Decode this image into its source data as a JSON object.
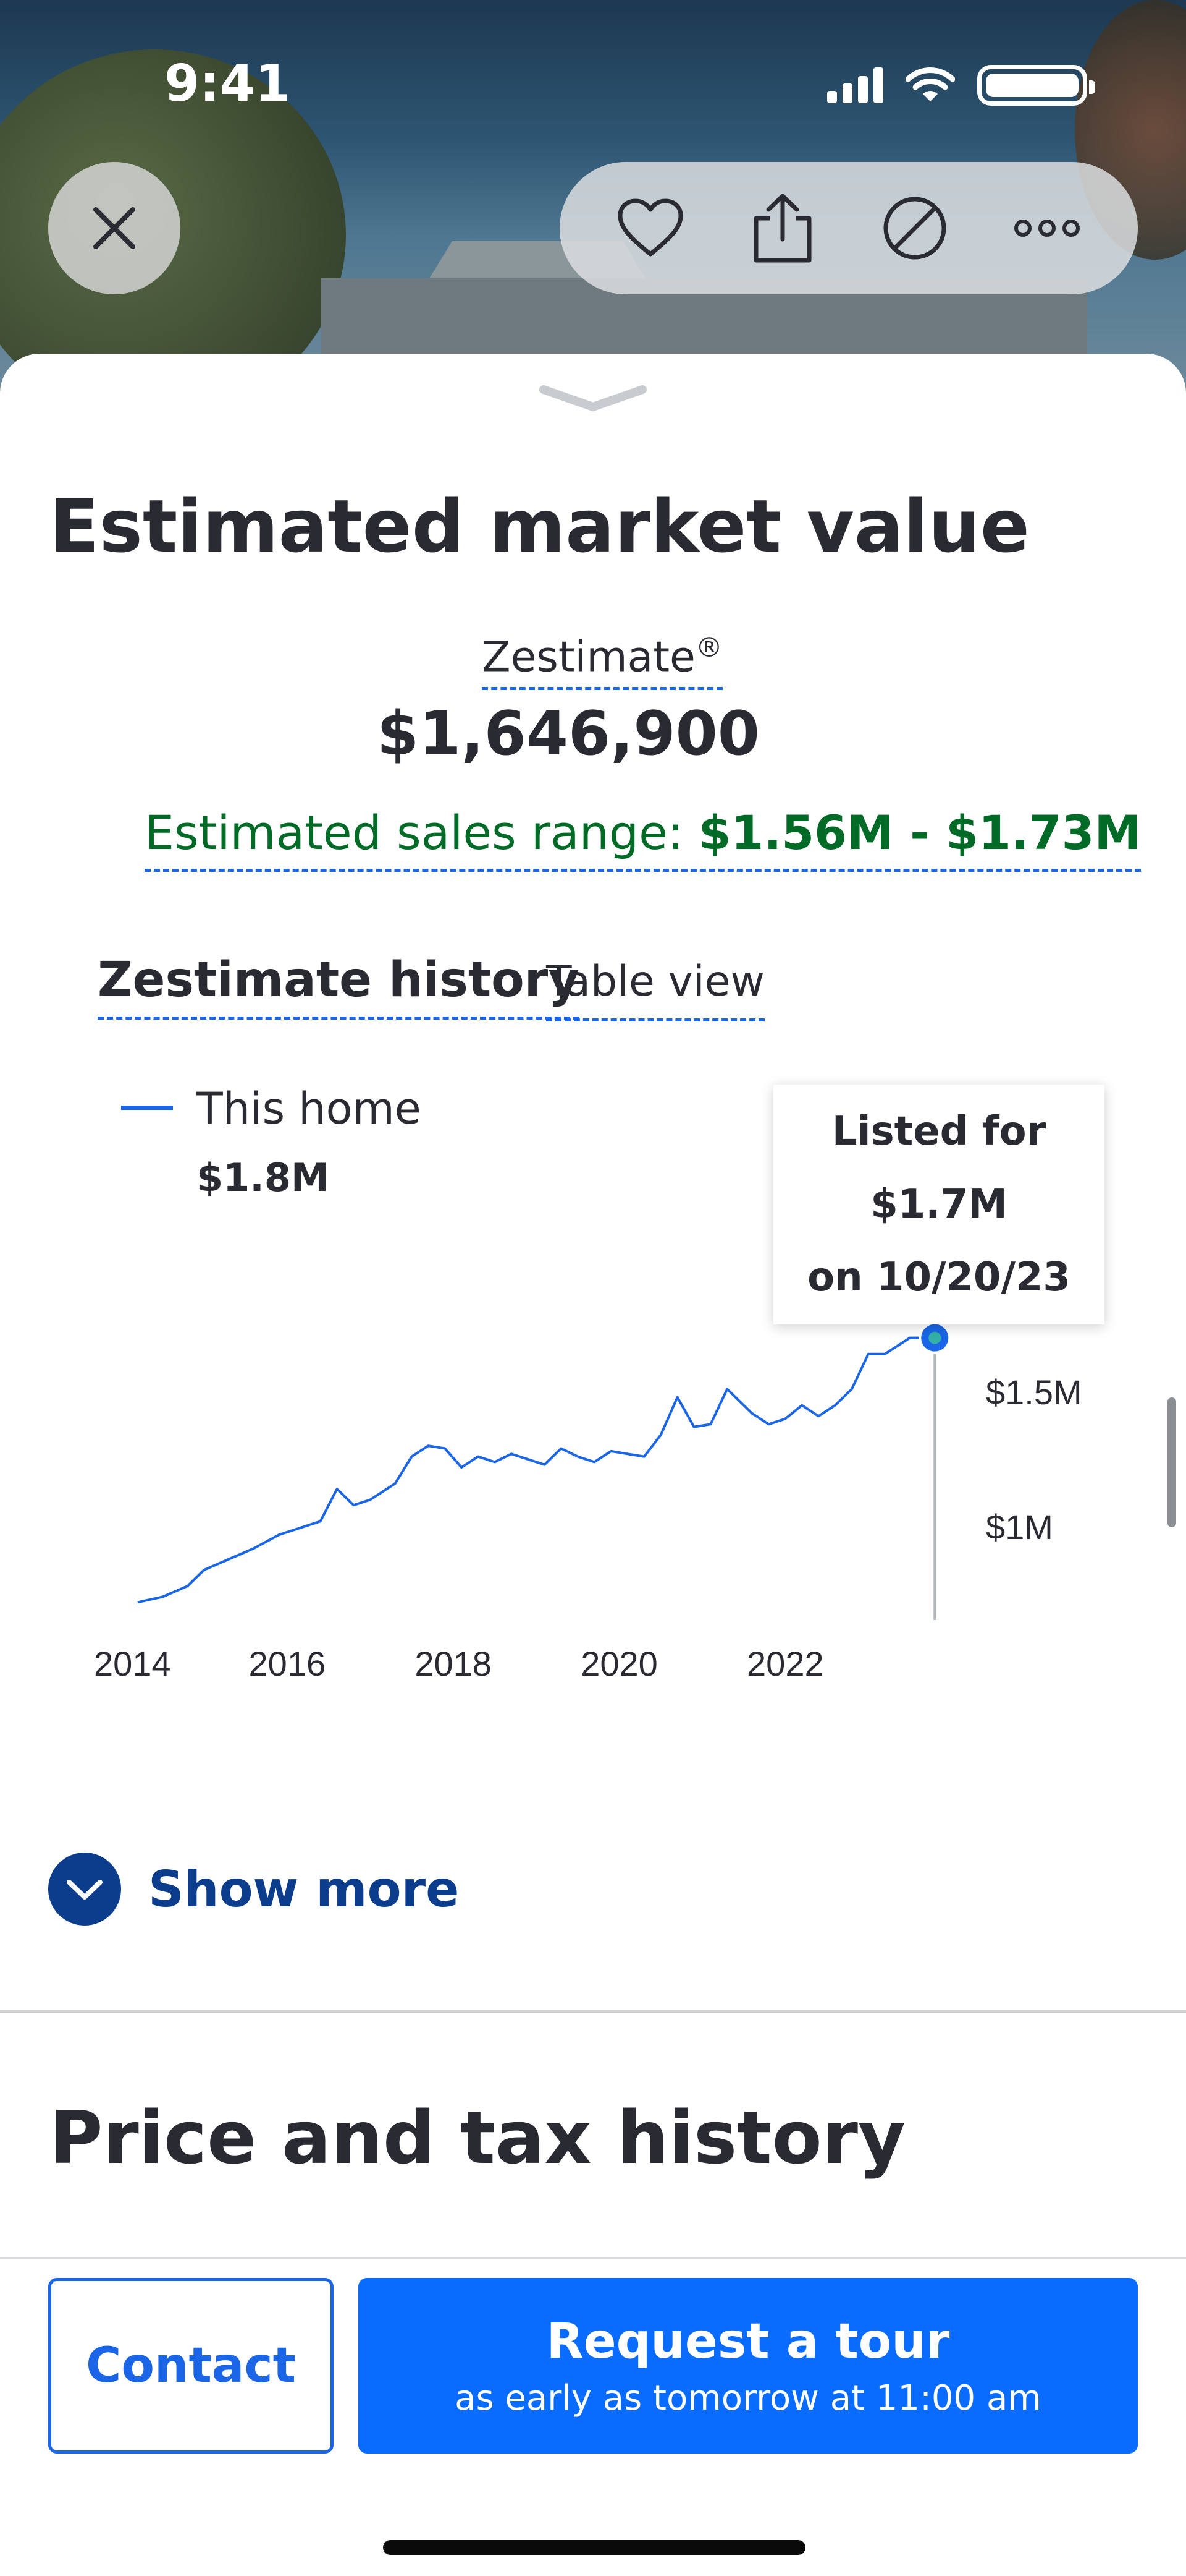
{
  "status_bar": {
    "time": "9:41"
  },
  "top_actions": {
    "close_icon": "close-icon",
    "icons": [
      "heart-icon",
      "share-icon",
      "hide-icon",
      "more-icon"
    ]
  },
  "zestimate_section": {
    "title": "Estimated market value",
    "zestimate_label": "Zestimate",
    "registered_mark": "®",
    "zestimate_value": "$1,646,900",
    "range_label": "Estimated sales range: ",
    "range_value": "$1.56M - $1.73M",
    "history_tab": "Zestimate history",
    "table_view": "Table view",
    "legend": {
      "name": "This home",
      "value": "$1.8M",
      "color": "#1a66e6"
    },
    "tooltip": {
      "line1": "Listed for",
      "line2": "$1.7M",
      "line3": "on 10/20/23"
    },
    "show_more": "Show more"
  },
  "chart_data": {
    "type": "line",
    "series": [
      {
        "name": "This home",
        "color": "#1a66e6",
        "x": [
          2014.2,
          2014.5,
          2014.8,
          2015.0,
          2015.3,
          2015.6,
          2015.9,
          2016.2,
          2016.4,
          2016.6,
          2016.8,
          2017.0,
          2017.3,
          2017.5,
          2017.7,
          2017.9,
          2018.1,
          2018.3,
          2018.5,
          2018.7,
          2018.9,
          2019.1,
          2019.3,
          2019.5,
          2019.7,
          2019.9,
          2020.1,
          2020.3,
          2020.5,
          2020.7,
          2020.9,
          2021.1,
          2021.3,
          2021.6,
          2021.8,
          2022.0,
          2022.2,
          2022.4,
          2022.6,
          2022.8,
          2023.0,
          2023.2,
          2023.5,
          2023.8
        ],
        "values": [
          0.72,
          0.74,
          0.78,
          0.84,
          0.88,
          0.92,
          0.97,
          1.0,
          1.02,
          1.14,
          1.08,
          1.1,
          1.16,
          1.26,
          1.3,
          1.29,
          1.22,
          1.26,
          1.24,
          1.27,
          1.25,
          1.23,
          1.29,
          1.26,
          1.24,
          1.28,
          1.27,
          1.26,
          1.34,
          1.48,
          1.37,
          1.38,
          1.51,
          1.42,
          1.38,
          1.4,
          1.45,
          1.41,
          1.45,
          1.51,
          1.64,
          1.64,
          1.7,
          1.7
        ]
      }
    ],
    "x_ticks": [
      "2014",
      "2016",
      "2018",
      "2020",
      "2022"
    ],
    "y_ticks": [
      "$1M",
      "$1.5M"
    ],
    "xlim": [
      2014,
      2023.85
    ],
    "ylim": [
      0.7,
      1.8
    ],
    "marker": {
      "x": 2023.8,
      "value": 1.7
    }
  },
  "price_tax": {
    "title": "Price and tax history"
  },
  "bottom_bar": {
    "contact": "Contact",
    "tour_title": "Request a tour",
    "tour_subtitle": "as early as tomorrow at 11:00 am"
  }
}
